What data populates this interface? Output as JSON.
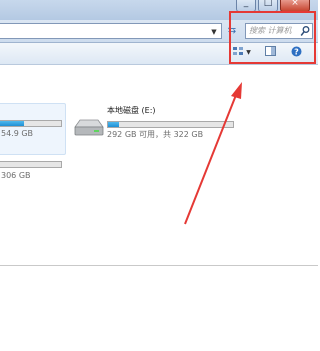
{
  "search": {
    "placeholder": "搜索 计算机"
  },
  "drives": [
    {
      "name": "",
      "size_text": "54.9 GB",
      "usage_fraction": 0.4
    },
    {
      "name": "",
      "size_text": "306 GB",
      "usage_fraction": 0.0
    },
    {
      "name": "本地磁盘 (E:)",
      "size_text": "292 GB 可用，共 322 GB",
      "usage_fraction": 0.09
    }
  ],
  "colors": {
    "annotation": "#e53935",
    "bar_fill": "#26a0da"
  },
  "icons": {
    "search": "search-icon",
    "refresh": "refresh-icon",
    "view": "view-options-icon",
    "preview": "preview-pane-icon",
    "help": "help-icon",
    "drive": "hard-drive-icon"
  }
}
